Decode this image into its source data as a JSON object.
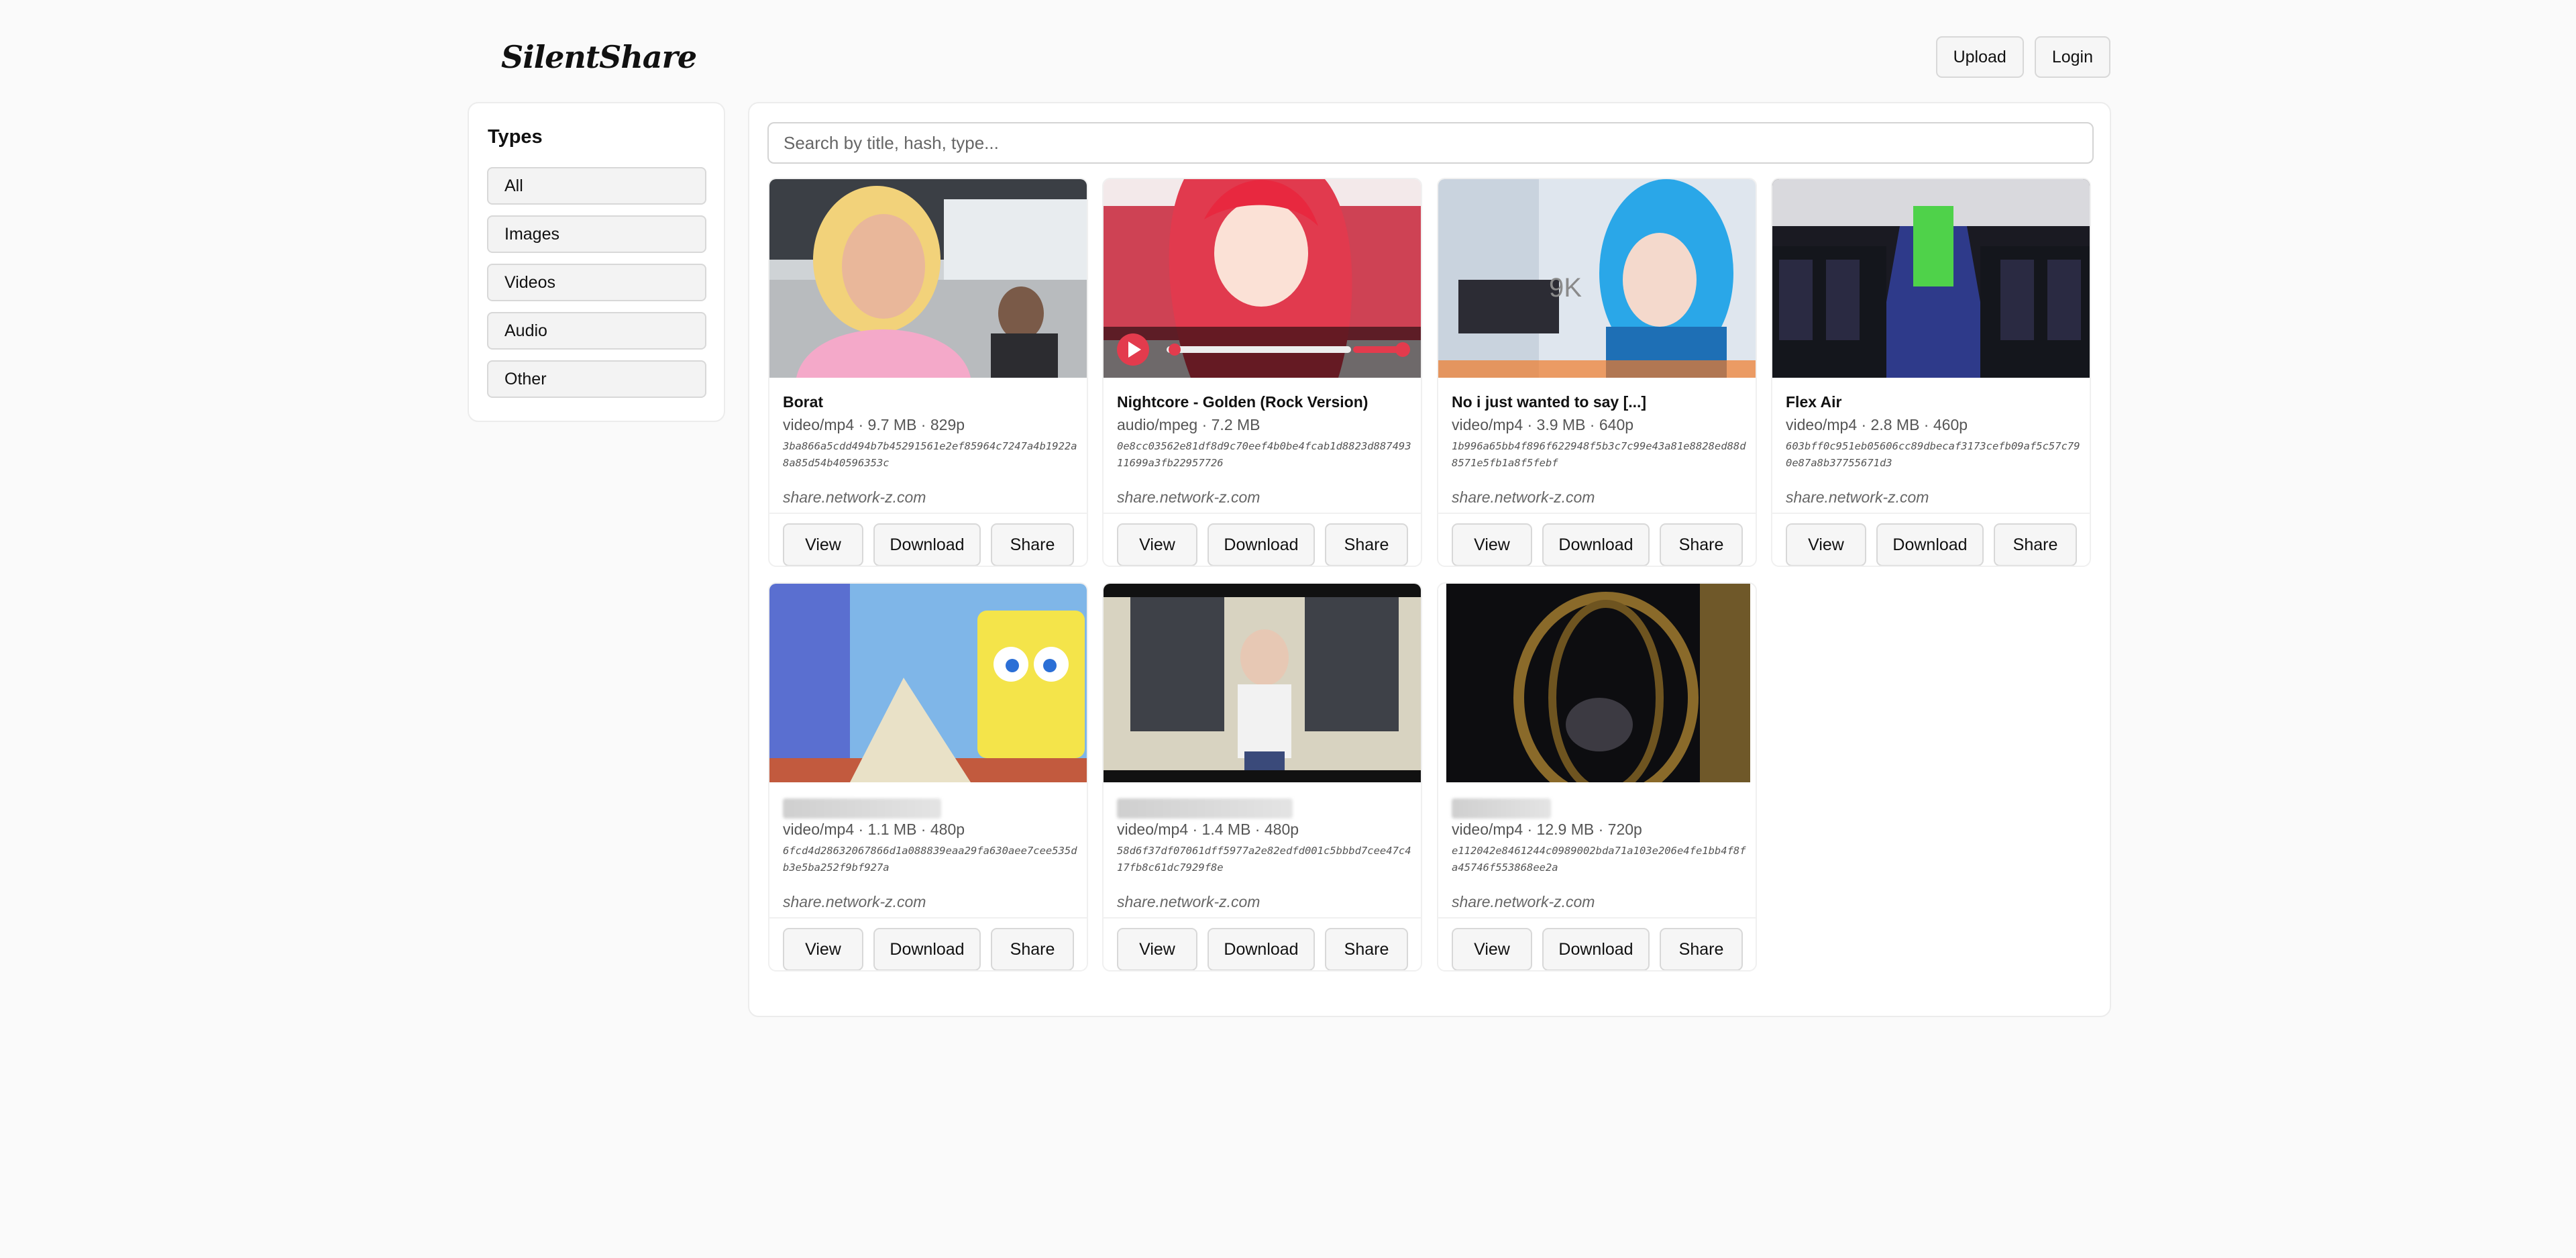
{
  "header": {
    "brand": "SilentShare",
    "upload_label": "Upload",
    "login_label": "Login"
  },
  "sidebar": {
    "title": "Types",
    "items": [
      {
        "label": "All"
      },
      {
        "label": "Images"
      },
      {
        "label": "Videos"
      },
      {
        "label": "Audio"
      },
      {
        "label": "Other"
      }
    ]
  },
  "search": {
    "placeholder": "Search by title, hash, type..."
  },
  "actions": {
    "view": "View",
    "download": "Download",
    "share": "Share"
  },
  "cards": [
    {
      "title": "Borat",
      "meta": "video/mp4 · 9.7 MB · 829p",
      "hash": "3ba866a5cdd494b7b45291561e2ef85964c7247a4b1922a8a85d54b40596353c",
      "host": "share.network-z.com"
    },
    {
      "title": "Nightcore - Golden (Rock Version)",
      "meta": "audio/mpeg · 7.2 MB",
      "hash": "0e8cc03562e81df8d9c70eef4b0be4fcab1d8823d88749311699a3fb22957726",
      "host": "share.network-z.com"
    },
    {
      "title": "No i just wanted to say [...]",
      "meta": "video/mp4 · 3.9 MB · 640p",
      "hash": "1b996a65bb4f896f622948f5b3c7c99e43a81e8828ed88d8571e5fb1a8f5febf",
      "host": "share.network-z.com"
    },
    {
      "title": "Flex Air",
      "meta": "video/mp4 · 2.8 MB · 460p",
      "hash": "603bff0c951eb05606cc89dbecaf3173cefb09af5c57c790e87a8b37755671d3",
      "host": "share.network-z.com"
    },
    {
      "title": "",
      "meta": "video/mp4 · 1.1 MB · 480p",
      "hash": "6fcd4d28632067866d1a088839eaa29fa630aee7cee535db3e5ba252f9bf927a",
      "host": "share.network-z.com"
    },
    {
      "title": "",
      "meta": "video/mp4 · 1.4 MB · 480p",
      "hash": "58d6f37df07061dff5977a2e82edfd001c5bbbd7cee47c417fb8c61dc7929f8e",
      "host": "share.network-z.com"
    },
    {
      "title": "",
      "meta": "video/mp4 · 12.9 MB · 720p",
      "hash": "e112042e8461244c0989002bda71a103e206e4fe1bb4f8fa45746f553868ee2a",
      "host": "share.network-z.com"
    }
  ],
  "thumbnails": [
    {
      "icon": "car-scene-thumbnail"
    },
    {
      "icon": "anime-girl-audio-thumbnail"
    },
    {
      "icon": "blue-hair-streamer-thumbnail",
      "overlay_text": "9K"
    },
    {
      "icon": "airplane-cabin-thumbnail"
    },
    {
      "icon": "spongebob-thumbnail"
    },
    {
      "icon": "anime-old-man-thumbnail"
    },
    {
      "icon": "dark-cage-thumbnail"
    }
  ]
}
